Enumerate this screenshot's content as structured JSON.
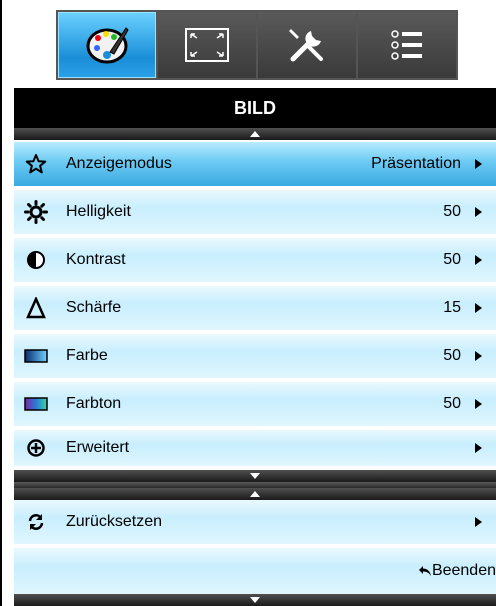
{
  "tabs": [
    {
      "icon": "palette-icon",
      "active": true
    },
    {
      "icon": "screen-frame-icon",
      "active": false
    },
    {
      "icon": "tools-icon",
      "active": false
    },
    {
      "icon": "options-list-icon",
      "active": false
    }
  ],
  "header": {
    "title": "BILD"
  },
  "menu": {
    "items": [
      {
        "icon": "star-icon",
        "label": "Anzeigemodus",
        "value": "Präsentation",
        "selected": true
      },
      {
        "icon": "brightness-icon",
        "label": "Helligkeit",
        "value": "50"
      },
      {
        "icon": "contrast-icon",
        "label": "Kontrast",
        "value": "50"
      },
      {
        "icon": "sharpness-icon",
        "label": "Schärfe",
        "value": "15"
      },
      {
        "icon": "color-icon",
        "label": "Farbe",
        "value": "50"
      },
      {
        "icon": "tint-icon",
        "label": "Farbton",
        "value": "50"
      },
      {
        "icon": "advanced-icon",
        "label": "Erweitert",
        "value": ""
      }
    ],
    "reset": {
      "icon": "refresh-icon",
      "label": "Zurücksetzen"
    }
  },
  "footer": {
    "exit_label": "Beenden",
    "exit_icon": "return-arrow-icon"
  },
  "colors": {
    "header_bg": "#000000",
    "selected_row": "#3aaae0",
    "row_bg": "#c9eefd",
    "tab_active": "#1a8fd8"
  }
}
